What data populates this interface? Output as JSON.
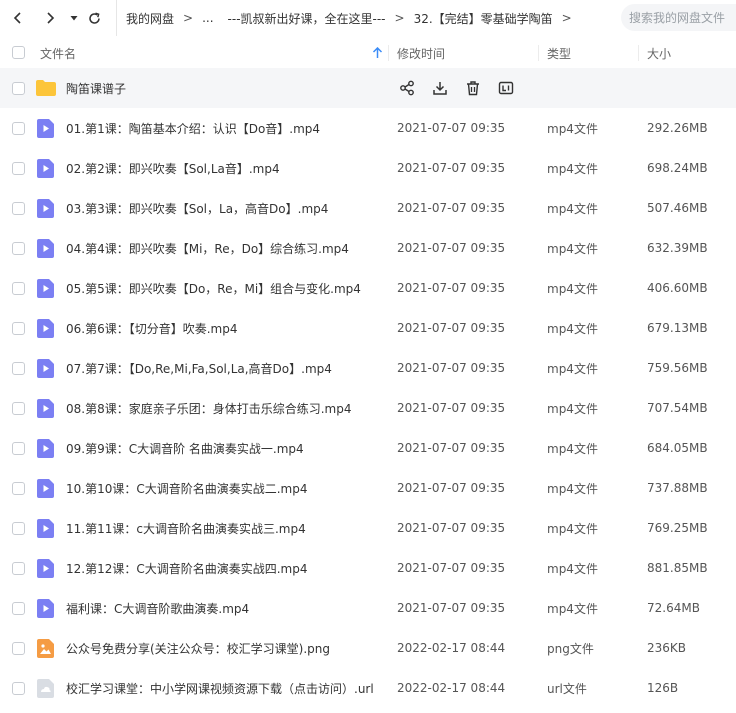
{
  "toolbar": {
    "search_placeholder": "搜索我的网盘文件",
    "breadcrumbs": [
      "我的网盘",
      "...",
      "---凯叔新出好课，全在这里---",
      "32.【完结】零基础学陶笛"
    ],
    "separator": ">"
  },
  "header": {
    "name": "文件名",
    "modified": "修改时间",
    "type": "类型",
    "size": "大小"
  },
  "folder": {
    "name": "陶笛课谱子",
    "actions": [
      "share-icon",
      "download-icon",
      "delete-icon",
      "rename-icon"
    ]
  },
  "files": [
    {
      "name": "01.第1课：陶笛基本介绍：认识【Do音】.mp4",
      "time": "2021-07-07 09:35",
      "type": "mp4文件",
      "size": "292.26MB",
      "icon": "video"
    },
    {
      "name": "02.第2课：即兴吹奏【Sol,La音】.mp4",
      "time": "2021-07-07 09:35",
      "type": "mp4文件",
      "size": "698.24MB",
      "icon": "video"
    },
    {
      "name": "03.第3课：即兴吹奏【Sol，La，高音Do】.mp4",
      "time": "2021-07-07 09:35",
      "type": "mp4文件",
      "size": "507.46MB",
      "icon": "video"
    },
    {
      "name": "04.第4课：即兴吹奏【Mi，Re，Do】综合练习.mp4",
      "time": "2021-07-07 09:35",
      "type": "mp4文件",
      "size": "632.39MB",
      "icon": "video"
    },
    {
      "name": "05.第5课：即兴吹奏【Do，Re，Mi】组合与变化.mp4",
      "time": "2021-07-07 09:35",
      "type": "mp4文件",
      "size": "406.60MB",
      "icon": "video"
    },
    {
      "name": "06.第6课：【切分音】吹奏.mp4",
      "time": "2021-07-07 09:35",
      "type": "mp4文件",
      "size": "679.13MB",
      "icon": "video"
    },
    {
      "name": "07.第7课：【Do,Re,Mi,Fa,Sol,La,高音Do】.mp4",
      "time": "2021-07-07 09:35",
      "type": "mp4文件",
      "size": "759.56MB",
      "icon": "video"
    },
    {
      "name": "08.第8课：家庭亲子乐团：身体打击乐综合练习.mp4",
      "time": "2021-07-07 09:35",
      "type": "mp4文件",
      "size": "707.54MB",
      "icon": "video"
    },
    {
      "name": "09.第9课：C大调音阶 名曲演奏实战一.mp4",
      "time": "2021-07-07 09:35",
      "type": "mp4文件",
      "size": "684.05MB",
      "icon": "video"
    },
    {
      "name": "10.第10课：C大调音阶名曲演奏实战二.mp4",
      "time": "2021-07-07 09:35",
      "type": "mp4文件",
      "size": "737.88MB",
      "icon": "video"
    },
    {
      "name": "11.第11课：c大调音阶名曲演奏实战三.mp4",
      "time": "2021-07-07 09:35",
      "type": "mp4文件",
      "size": "769.25MB",
      "icon": "video"
    },
    {
      "name": "12.第12课：C大调音阶名曲演奏实战四.mp4",
      "time": "2021-07-07 09:35",
      "type": "mp4文件",
      "size": "881.85MB",
      "icon": "video"
    },
    {
      "name": "福利课：C大调音阶歌曲演奏.mp4",
      "time": "2021-07-07 09:35",
      "type": "mp4文件",
      "size": "72.64MB",
      "icon": "video"
    },
    {
      "name": "公众号免费分享(关注公众号：校汇学习课堂).png",
      "time": "2022-02-17 08:44",
      "type": "png文件",
      "size": "236KB",
      "icon": "image"
    },
    {
      "name": "校汇学习课堂：中小学网课视频资源下载（点击访问）.url",
      "time": "2022-02-17 08:44",
      "type": "url文件",
      "size": "126B",
      "icon": "url"
    }
  ],
  "colors": {
    "video_icon": "#7b7ff3",
    "image_icon": "#f59c44",
    "url_icon": "#d9dde3",
    "folder_icon": "#fcc53a",
    "hover_row": "#f5f6f8",
    "sort_arrow": "#3b8cf7"
  }
}
